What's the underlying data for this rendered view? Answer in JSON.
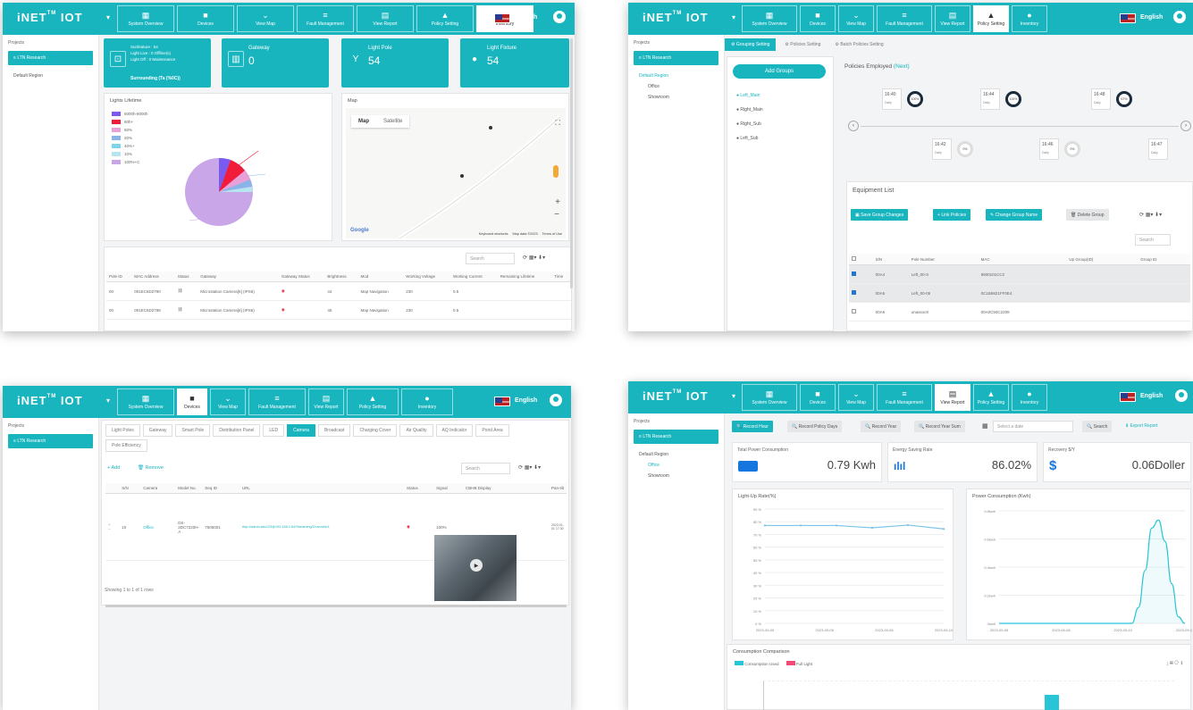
{
  "header": {
    "logo": "iNET",
    "logo_tm": "TM",
    "logo_suffix": " IOT",
    "language": "English"
  },
  "nav_items": [
    "System Overview",
    "Devices",
    "View Map",
    "Fault Management",
    "View Report",
    "Policy Setting",
    "Inventory"
  ],
  "sidebar": {
    "header": "Projects",
    "project_button": "LTN Research",
    "default_region": "Default Region",
    "office": "Office",
    "showroom": "Showroom"
  },
  "panel1": {
    "stats": [
      {
        "lines": [
          "Sunfeature : 54",
          "Light Live : 0 Offline(s)",
          "Light Off : 0 Maintenance"
        ],
        "footer": "Surrounding (Ta (%0C))"
      },
      {
        "label": "Gateway",
        "value": "0"
      },
      {
        "label": "Light Pole",
        "value": "54"
      },
      {
        "label": "Light Fixture",
        "value": "54"
      }
    ],
    "lights_lifetime_title": "Lights Lifetime",
    "map_title": "Map",
    "map_tabs": [
      "Map",
      "Satellite"
    ],
    "map_attrib": [
      "Keyboard shortcuts",
      "Map data ©2023",
      "Terms of Use"
    ],
    "map_logo": "Google",
    "search_placeholder": "Search",
    "table_headers": [
      "Pole ID",
      "MAC Address",
      "Status",
      "Gateway",
      "Gateway Status",
      "Brightness",
      "Mod",
      "Working Voltage",
      "Working Current",
      "Remaining Lifetime",
      "Time"
    ],
    "rows": [
      {
        "id": "00",
        "mac": "001EC6D2790",
        "gateway": "Microstation Camera[6] (IPS6)",
        "brightness": "44",
        "mode": "Map Navigation",
        "voltage": "230",
        "current": "0.5"
      },
      {
        "id": "00",
        "mac": "001EC6D2798",
        "gateway": "Microstation Camera[6] (IPS6)",
        "brightness": "45",
        "mode": "Map Navigation",
        "voltage": "230",
        "current": "0.5"
      }
    ]
  },
  "lifetime_chart": {
    "legend": [
      "5000h-8000h",
      "80h+",
      "50%",
      "20%",
      "40%+",
      "10%",
      "100%+C"
    ],
    "legend_colors": [
      "#7a5af0",
      "#f01c3a",
      "#e8a0d8",
      "#8ab4e8",
      "#7ad6e8",
      "#b8e4f0",
      "#c8a6e8"
    ]
  },
  "panel2": {
    "tabs": [
      "Grouping Setting",
      "Policies Setting",
      "Batch Policies Setting"
    ],
    "add_groups": "Add Groups",
    "groups": [
      "Left_Main",
      "Right_Main",
      "Right_Sub",
      "Left_Sub"
    ],
    "policies_title": "Policies Employed",
    "policies_title_accent": "(Next)",
    "timeline_top": [
      {
        "time": "16:40",
        "freq": "Daily",
        "pct": "100%"
      },
      {
        "time": "16:44",
        "freq": "Daily",
        "pct": "100%"
      },
      {
        "time": "16:48",
        "freq": "Daily",
        "pct": "67%"
      }
    ],
    "timeline_bottom": [
      {
        "time": "16:42",
        "freq": "Daily",
        "pct": "0%"
      },
      {
        "time": "16:46",
        "freq": "Daily",
        "pct": "0%"
      },
      {
        "time": "16:47",
        "freq": "Daily"
      }
    ],
    "equipment_title": "Equipment List",
    "buttons": [
      "Save Group Changes",
      "Link Policies",
      "Change Group Name",
      "Delete Group"
    ],
    "search_placeholder": "Search",
    "table_headers": [
      "S/N",
      "Pole Number",
      "MAC",
      "Up Group(ID)",
      "Group ID"
    ],
    "rows": [
      {
        "sn": "00A4",
        "pole": "Left_00-S",
        "mac": "8900101CC2",
        "checked": true
      },
      {
        "sn": "00A5",
        "pole": "Left_00-05",
        "mac": "0C1B6821FF0E4",
        "checked": true
      },
      {
        "sn": "00A6",
        "pole": "unassoc8",
        "mac": "00A0C50C2208",
        "checked": false
      }
    ]
  },
  "panel3": {
    "tabs": [
      "Light Poles",
      "Gateway",
      "Smart Pole",
      "Distribution Panel",
      "LED",
      "Camera",
      "Broadcast",
      "Charging Cover",
      "Air Quality",
      "AQ Indicator",
      "Pond Area",
      "Pole Efficiency"
    ],
    "add_label": "Add",
    "remove_label": "Remove",
    "search_placeholder": "Search",
    "table_headers": [
      "S/N",
      "Camera",
      "Model No.",
      "Seq ID",
      "URL",
      "Status",
      "Signal",
      "CBHB Display",
      "Pan-tilt"
    ],
    "row": {
      "sn": "10",
      "camera": "Office",
      "model": "DS-2DC7220H-A",
      "seq": "7505001",
      "url": "rtsp://admin:abc123@192.168.1.64/Streaming/Channels/1",
      "signal": "100%",
      "extra": "2023-01-01 17:30"
    },
    "footer": "Showing 1 to 1 of 1 rows"
  },
  "panel4": {
    "toolbar": [
      "Record Hour",
      "Record Policy Days",
      "Record Year",
      "Record Year Sum"
    ],
    "date_placeholder": "Select a date",
    "search_label": "Search",
    "export_label": "Export Report",
    "metrics": [
      {
        "label": "Total Power Consumption",
        "value": "0.79 Kwh"
      },
      {
        "label": "Energy Saving Rate",
        "value": "86.02%"
      },
      {
        "label": "Recovery $/Y",
        "value": "0.06Doller"
      }
    ],
    "chart1_title": "Light-Up Rate(%)",
    "chart2_title": "Power Consumption (Kwh)",
    "comparison_title": "Consumption Comparison",
    "legend": [
      "Consumption Used",
      "Full Light"
    ]
  },
  "lightup_chart": {
    "type": "line",
    "x": [
      "2023-09-05",
      "2023-09-06",
      "2023-09-07",
      "2023-09-08",
      "2023-09-09",
      "2023-09-10"
    ],
    "y_ticks": [
      "90 %",
      "80 %",
      "70 %",
      "60 %",
      "50 %",
      "40 %",
      "30 %",
      "20 %",
      "10 %",
      "0 %"
    ],
    "x_ticks": [
      "2023-09-05",
      "2023-09-06",
      "2023-09-08",
      "2023-09-10"
    ],
    "values": [
      85.6,
      85.6,
      85.6,
      83.6,
      86.0,
      82.6
    ],
    "ylim": [
      0,
      100
    ],
    "color": "#7ec4e8"
  },
  "power_chart": {
    "type": "area",
    "y_ticks": [
      "0.8kwh",
      "0.6kwh",
      "0.4kwh",
      "0.2kwh",
      "0kwh"
    ],
    "x_ticks": [
      "2023-09-05",
      "2023-09-08",
      "2023-09-10",
      "2023-09-11"
    ],
    "values": [
      0,
      0,
      0,
      0,
      0,
      0,
      0,
      0,
      0,
      0,
      0,
      0,
      0,
      0,
      0,
      0,
      0,
      0,
      0,
      0,
      0,
      0.12,
      0.4,
      0.72,
      0.78,
      0.62,
      0.3,
      0.05,
      0
    ],
    "ylim": [
      0,
      0.85
    ],
    "color": "#27c5d6"
  }
}
